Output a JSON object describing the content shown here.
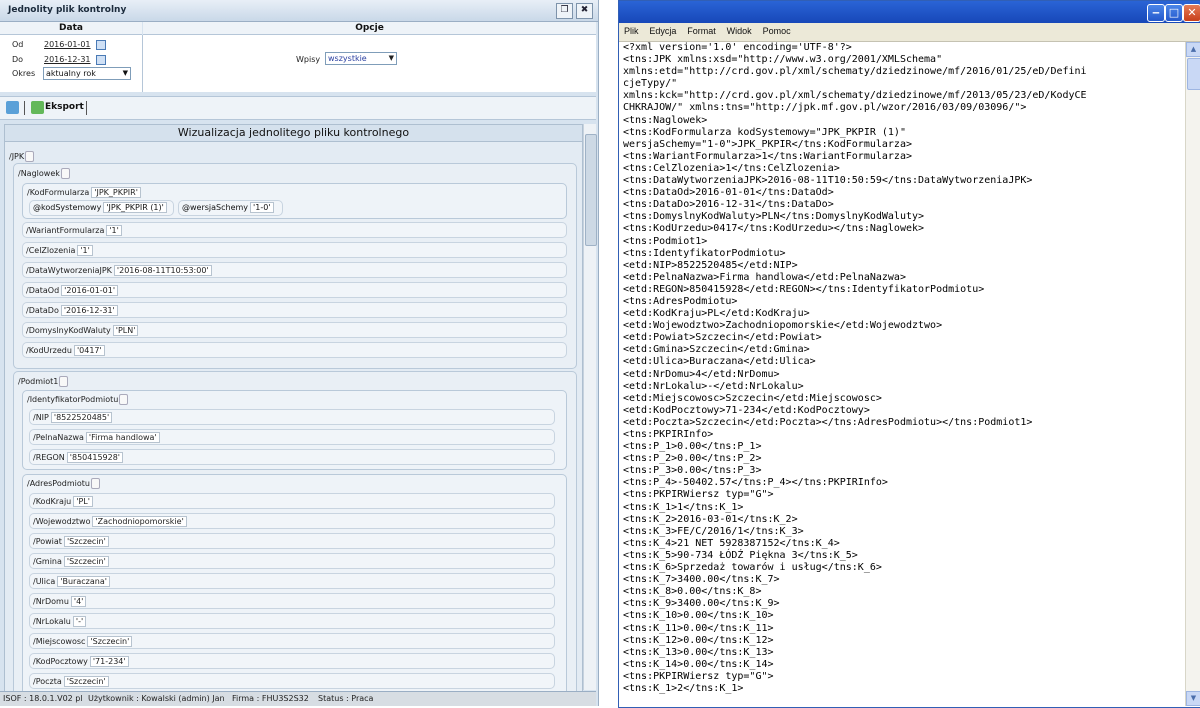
{
  "left": {
    "title": "Jednolity plik kontrolny",
    "col_data": "Data",
    "col_opcje": "Opcje",
    "od_label": "Od",
    "od_value": "2016-01-01",
    "do_label": "Do",
    "do_value": "2016-12-31",
    "okres_label": "Okres",
    "okres_value": "aktualny rok",
    "wpisy_label": "Wpisy",
    "wpisy_value": "wszystkie",
    "eksport_label": "Eksport",
    "viz_title": "Wizualizacja jednolitego pliku kontrolnego",
    "tree": {
      "jpk": "/JPK",
      "naglowek": "/Naglowek",
      "kodformularza": "/KodFormularza",
      "kodformularza_v": "'JPK_PKPIR'",
      "kodsystemowy": "@kodSystemowy",
      "kodsystemowy_v": "'JPK_PKPIR (1)'",
      "wersjaschemy": "@wersjaSchemy",
      "wersjaschemy_v": "'1-0'",
      "rows1": [
        {
          "n": "/WariantFormularza",
          "v": "'1'"
        },
        {
          "n": "/CelZlozenia",
          "v": "'1'"
        },
        {
          "n": "/DataWytworzeniaJPK",
          "v": "'2016-08-11T10:53:00'"
        },
        {
          "n": "/DataOd",
          "v": "'2016-01-01'"
        },
        {
          "n": "/DataDo",
          "v": "'2016-12-31'"
        },
        {
          "n": "/DomyslnyKodWaluty",
          "v": "'PLN'"
        },
        {
          "n": "/KodUrzedu",
          "v": "'0417'"
        }
      ],
      "podmiot1": "/Podmiot1",
      "identyfikator": "/IdentyfikatorPodmiotu",
      "rows2": [
        {
          "n": "/NIP",
          "v": "'8522520485'"
        },
        {
          "n": "/PelnaNazwa",
          "v": "'Firma handlowa'"
        },
        {
          "n": "/REGON",
          "v": "'850415928'"
        }
      ],
      "adres": "/AdresPodmiotu",
      "rows3": [
        {
          "n": "/KodKraju",
          "v": "'PL'"
        },
        {
          "n": "/Wojewodztwo",
          "v": "'Zachodniopomorskie'"
        },
        {
          "n": "/Powiat",
          "v": "'Szczecin'"
        },
        {
          "n": "/Gmina",
          "v": "'Szczecin'"
        },
        {
          "n": "/Ulica",
          "v": "'Buraczana'"
        },
        {
          "n": "/NrDomu",
          "v": "'4'"
        },
        {
          "n": "/NrLokalu",
          "v": "'-'"
        },
        {
          "n": "/Miejscowosc",
          "v": "'Szczecin'"
        },
        {
          "n": "/KodPocztowy",
          "v": "'71-234'"
        },
        {
          "n": "/Poczta",
          "v": "'Szczecin'"
        }
      ]
    },
    "status": {
      "version": "ISOF : 18.0.1.V02 pl",
      "user": "Użytkownik : Kowalski (admin) Jan",
      "firma": "Firma : FHU3S2S32",
      "stat": "Status : Praca"
    }
  },
  "notepad": {
    "menu": [
      "Plik",
      "Edycja",
      "Format",
      "Widok",
      "Pomoc"
    ],
    "lines": [
      "<?xml version='1.0' encoding='UTF-8'?>",
      "<tns:JPK xmlns:xsd=\"http://www.w3.org/2001/XMLSchema\"",
      "xmlns:etd=\"http://crd.gov.pl/xml/schematy/dziedzinowe/mf/2016/01/25/eD/Defini",
      "cjeTypy/\"",
      "xmlns:kck=\"http://crd.gov.pl/xml/schematy/dziedzinowe/mf/2013/05/23/eD/KodyCE",
      "CHKRAJOW/\" xmlns:tns=\"http://jpk.mf.gov.pl/wzor/2016/03/09/03096/\">",
      "<tns:Naglowek>",
      "<tns:KodFormularza kodSystemowy=\"JPK_PKPIR (1)\"",
      "wersjaSchemy=\"1-0\">JPK_PKPIR</tns:KodFormularza>",
      "<tns:WariantFormularza>1</tns:WariantFormularza>",
      "<tns:CelZlozenia>1</tns:CelZlozenia>",
      "<tns:DataWytworzeniaJPK>2016-08-11T10:50:59</tns:DataWytworzeniaJPK>",
      "<tns:DataOd>2016-01-01</tns:DataOd>",
      "<tns:DataDo>2016-12-31</tns:DataDo>",
      "<tns:DomyslnyKodWaluty>PLN</tns:DomyslnyKodWaluty>",
      "<tns:KodUrzedu>0417</tns:KodUrzedu></tns:Naglowek>",
      "<tns:Podmiot1>",
      "<tns:IdentyfikatorPodmiotu>",
      "<etd:NIP>8522520485</etd:NIP>",
      "<etd:PelnaNazwa>Firma handlowa</etd:PelnaNazwa>",
      "<etd:REGON>850415928</etd:REGON></tns:IdentyfikatorPodmiotu>",
      "<tns:AdresPodmiotu>",
      "<etd:KodKraju>PL</etd:KodKraju>",
      "<etd:Wojewodztwo>Zachodniopomorskie</etd:Wojewodztwo>",
      "<etd:Powiat>Szczecin</etd:Powiat>",
      "<etd:Gmina>Szczecin</etd:Gmina>",
      "<etd:Ulica>Buraczana</etd:Ulica>",
      "<etd:NrDomu>4</etd:NrDomu>",
      "<etd:NrLokalu>-</etd:NrLokalu>",
      "<etd:Miejscowosc>Szczecin</etd:Miejscowosc>",
      "<etd:KodPocztowy>71-234</etd:KodPocztowy>",
      "<etd:Poczta>Szczecin</etd:Poczta></tns:AdresPodmiotu></tns:Podmiot1>",
      "<tns:PKPIRInfo>",
      "<tns:P_1>0.00</tns:P_1>",
      "<tns:P_2>0.00</tns:P_2>",
      "<tns:P_3>0.00</tns:P_3>",
      "<tns:P_4>-50402.57</tns:P_4></tns:PKPIRInfo>",
      "<tns:PKPIRWiersz typ=\"G\">",
      "<tns:K_1>1</tns:K_1>",
      "<tns:K_2>2016-03-01</tns:K_2>",
      "<tns:K_3>FE/C/2016/1</tns:K_3>",
      "<tns:K_4>21 NET 5928387152</tns:K_4>",
      "<tns:K_5>90-734 ŁÓDŹ Piękna 3</tns:K_5>",
      "<tns:K_6>Sprzedaż towarów i usług</tns:K_6>",
      "<tns:K_7>3400.00</tns:K_7>",
      "<tns:K_8>0.00</tns:K_8>",
      "<tns:K_9>3400.00</tns:K_9>",
      "<tns:K_10>0.00</tns:K_10>",
      "<tns:K_11>0.00</tns:K_11>",
      "<tns:K_12>0.00</tns:K_12>",
      "<tns:K_13>0.00</tns:K_13>",
      "<tns:K_14>0.00</tns:K_14>",
      "<tns:PKPIRWiersz typ=\"G\">",
      "<tns:K_1>2</tns:K_1>"
    ]
  }
}
